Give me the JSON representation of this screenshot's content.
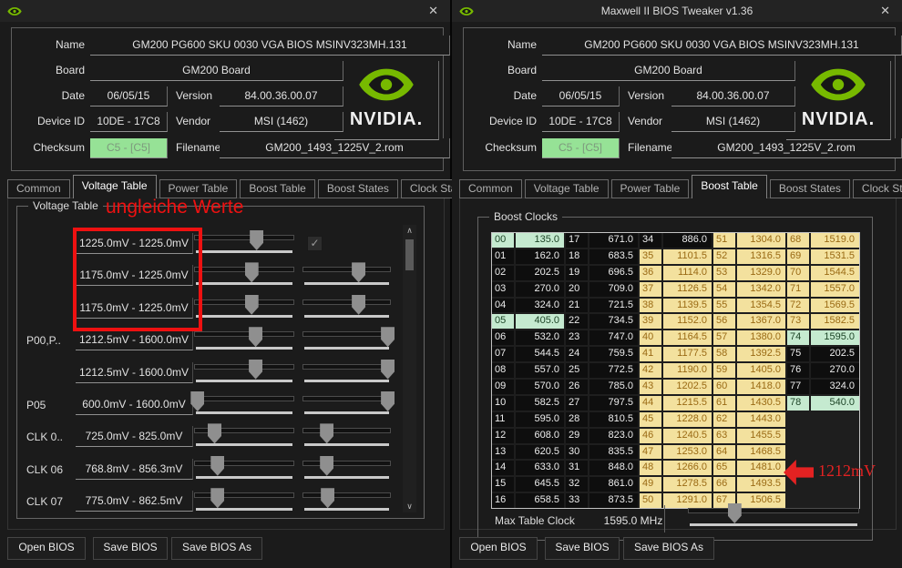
{
  "icons": {
    "close": "✕",
    "check": "✓",
    "scroll_up": "∧",
    "scroll_down": "∨"
  },
  "colors": {
    "nvidia_green": "#77b900",
    "checksum_bg": "#96e296",
    "cell_yellow": "#f3e19e",
    "cell_green": "#c5ead0",
    "annotation_red": "#ee1111"
  },
  "left_window": {
    "title": "",
    "header": {
      "name_label": "Name",
      "name": "GM200 PG600 SKU 0030 VGA BIOS MSINV323MH.131",
      "board_label": "Board",
      "board": "GM200 Board",
      "date_label": "Date",
      "date": "06/05/15",
      "version_label": "Version",
      "version": "84.00.36.00.07",
      "device_id_label": "Device ID",
      "device_id": "10DE - 17C8",
      "vendor_label": "Vendor",
      "vendor": "MSI (1462)",
      "checksum_label": "Checksum",
      "checksum": "C5 - [C5]",
      "filename_label": "Filename",
      "filename": "GM200_1493_1225V_2.rom",
      "logo_text": "NVIDIA."
    },
    "tabs": {
      "labels": [
        "Common",
        "Voltage Table",
        "Power Table",
        "Boost Table",
        "Boost States",
        "Clock States"
      ],
      "selected": 1
    },
    "voltage_table": {
      "title": "Voltage Table",
      "rows": [
        {
          "label": "",
          "range": "1225.0mV - 1225.0mV",
          "sliders": [
            62
          ],
          "checkbox": true
        },
        {
          "label": "",
          "range": "1175.0mV - 1225.0mV",
          "sliders": [
            57,
            63
          ]
        },
        {
          "label": "",
          "range": "1175.0mV - 1225.0mV",
          "sliders": [
            57,
            63
          ]
        },
        {
          "label": "P00,P..",
          "range": "1212.5mV - 1600.0mV",
          "sliders": [
            61,
            96
          ]
        },
        {
          "label": "",
          "range": "1212.5mV - 1600.0mV",
          "sliders": [
            61,
            96
          ]
        },
        {
          "label": "P05",
          "range": "600.0mV - 1600.0mV",
          "sliders": [
            3,
            96
          ]
        },
        {
          "label": "CLK 0..",
          "range": "725.0mV - 825.0mV",
          "sliders": [
            20,
            27
          ]
        },
        {
          "label": "CLK 06",
          "range": "768.8mV - 856.3mV",
          "sliders": [
            23,
            27
          ]
        },
        {
          "label": "CLK 07",
          "range": "775.0mV - 862.5mV",
          "sliders": [
            23,
            28
          ]
        }
      ]
    },
    "annotation": {
      "text": "ungleiche Werte"
    },
    "footer": [
      "Open BIOS",
      "Save BIOS",
      "Save BIOS As"
    ]
  },
  "right_window": {
    "title": "Maxwell II BIOS Tweaker v1.36",
    "header": {
      "name_label": "Name",
      "name": "GM200 PG600 SKU 0030 VGA BIOS MSINV323MH.131",
      "board_label": "Board",
      "board": "GM200 Board",
      "date_label": "Date",
      "date": "06/05/15",
      "version_label": "Version",
      "version": "84.00.36.00.07",
      "device_id_label": "Device ID",
      "device_id": "10DE - 17C8",
      "vendor_label": "Vendor",
      "vendor": "MSI (1462)",
      "checksum_label": "Checksum",
      "checksum": "C5 - [C5]",
      "filename_label": "Filename",
      "filename": "GM200_1493_1225V_2.rom",
      "logo_text": "NVIDIA."
    },
    "tabs": {
      "labels": [
        "Common",
        "Voltage Table",
        "Power Table",
        "Boost Table",
        "Boost States",
        "Clock States"
      ],
      "selected": 3
    },
    "boost_clocks": {
      "title": "Boost Clocks",
      "entries": [
        [
          "00",
          "135.0",
          "g"
        ],
        [
          "01",
          "162.0",
          "d"
        ],
        [
          "02",
          "202.5",
          "d"
        ],
        [
          "03",
          "270.0",
          "d"
        ],
        [
          "04",
          "324.0",
          "d"
        ],
        [
          "05",
          "405.0",
          "g"
        ],
        [
          "06",
          "532.0",
          "d"
        ],
        [
          "07",
          "544.5",
          "d"
        ],
        [
          "08",
          "557.0",
          "d"
        ],
        [
          "09",
          "570.0",
          "d"
        ],
        [
          "10",
          "582.5",
          "d"
        ],
        [
          "11",
          "595.0",
          "d"
        ],
        [
          "12",
          "608.0",
          "d"
        ],
        [
          "13",
          "620.5",
          "d"
        ],
        [
          "14",
          "633.0",
          "d"
        ],
        [
          "15",
          "645.5",
          "d"
        ],
        [
          "16",
          "658.5",
          "d"
        ],
        [
          "17",
          "671.0",
          "d"
        ],
        [
          "18",
          "683.5",
          "d"
        ],
        [
          "19",
          "696.5",
          "d"
        ],
        [
          "20",
          "709.0",
          "d"
        ],
        [
          "21",
          "721.5",
          "d"
        ],
        [
          "22",
          "734.5",
          "d"
        ],
        [
          "23",
          "747.0",
          "d"
        ],
        [
          "24",
          "759.5",
          "d"
        ],
        [
          "25",
          "772.5",
          "d"
        ],
        [
          "26",
          "785.0",
          "d"
        ],
        [
          "27",
          "797.5",
          "d"
        ],
        [
          "28",
          "810.5",
          "d"
        ],
        [
          "29",
          "823.0",
          "d"
        ],
        [
          "30",
          "835.5",
          "d"
        ],
        [
          "31",
          "848.0",
          "d"
        ],
        [
          "32",
          "861.0",
          "d"
        ],
        [
          "33",
          "873.5",
          "d"
        ],
        [
          "34",
          "886.0",
          "d"
        ],
        [
          "35",
          "1101.5",
          "y"
        ],
        [
          "36",
          "1114.0",
          "y"
        ],
        [
          "37",
          "1126.5",
          "y"
        ],
        [
          "38",
          "1139.5",
          "y"
        ],
        [
          "39",
          "1152.0",
          "y"
        ],
        [
          "40",
          "1164.5",
          "y"
        ],
        [
          "41",
          "1177.5",
          "y"
        ],
        [
          "42",
          "1190.0",
          "y"
        ],
        [
          "43",
          "1202.5",
          "y"
        ],
        [
          "44",
          "1215.5",
          "y"
        ],
        [
          "45",
          "1228.0",
          "y"
        ],
        [
          "46",
          "1240.5",
          "y"
        ],
        [
          "47",
          "1253.0",
          "y"
        ],
        [
          "48",
          "1266.0",
          "y"
        ],
        [
          "49",
          "1278.5",
          "y"
        ],
        [
          "50",
          "1291.0",
          "y"
        ],
        [
          "51",
          "1304.0",
          "y"
        ],
        [
          "52",
          "1316.5",
          "y"
        ],
        [
          "53",
          "1329.0",
          "y"
        ],
        [
          "54",
          "1342.0",
          "y"
        ],
        [
          "55",
          "1354.5",
          "y"
        ],
        [
          "56",
          "1367.0",
          "y"
        ],
        [
          "57",
          "1380.0",
          "y"
        ],
        [
          "58",
          "1392.5",
          "y"
        ],
        [
          "59",
          "1405.0",
          "y"
        ],
        [
          "60",
          "1418.0",
          "y"
        ],
        [
          "61",
          "1430.5",
          "y"
        ],
        [
          "62",
          "1443.0",
          "y"
        ],
        [
          "63",
          "1455.5",
          "y"
        ],
        [
          "64",
          "1468.5",
          "y"
        ],
        [
          "65",
          "1481.0",
          "y"
        ],
        [
          "66",
          "1493.5",
          "y"
        ],
        [
          "67",
          "1506.5",
          "y"
        ],
        [
          "68",
          "1519.0",
          "y"
        ],
        [
          "69",
          "1531.5",
          "y"
        ],
        [
          "70",
          "1544.5",
          "y"
        ],
        [
          "71",
          "1557.0",
          "y"
        ],
        [
          "72",
          "1569.5",
          "y"
        ],
        [
          "73",
          "1582.5",
          "y"
        ],
        [
          "74",
          "1595.0",
          "g"
        ],
        [
          "75",
          "202.5",
          "d"
        ],
        [
          "76",
          "270.0",
          "d"
        ],
        [
          "77",
          "324.0",
          "d"
        ],
        [
          "78",
          "540.0",
          "g"
        ]
      ],
      "max_table_clock": {
        "label": "Max Table Clock",
        "value": "1595.0 MHz",
        "slider": 27
      }
    },
    "annotation": {
      "text": "1212mV"
    },
    "footer": [
      "Open BIOS",
      "Save BIOS",
      "Save BIOS As"
    ]
  }
}
